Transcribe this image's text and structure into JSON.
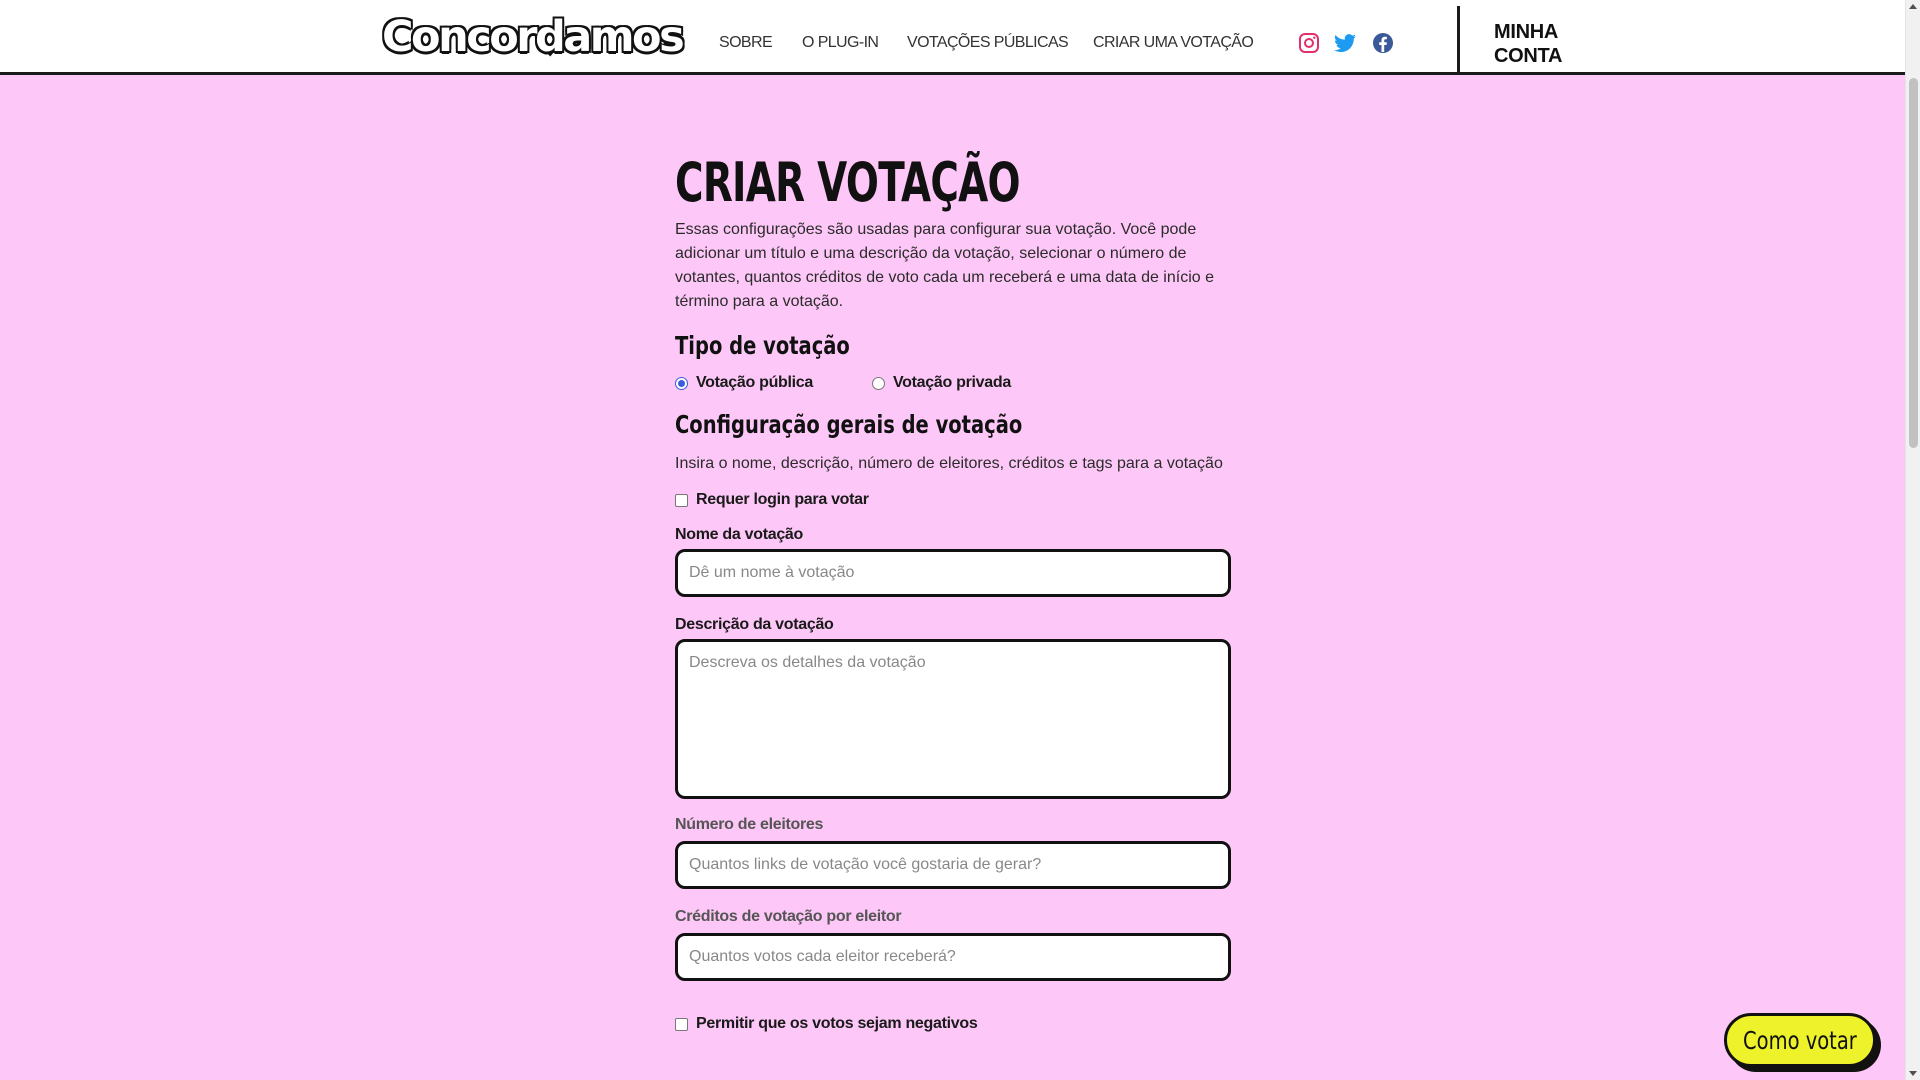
{
  "header": {
    "logo": "Concordamos",
    "nav": [
      {
        "label": "SOBRE"
      },
      {
        "label": "O PLUG-IN"
      },
      {
        "label": "VOTAÇÕES PÚBLICAS"
      },
      {
        "label": "CRIAR UMA VOTAÇÃO"
      }
    ],
    "social": [
      {
        "icon": "instagram-icon",
        "color": "#e1306c"
      },
      {
        "icon": "twitter-icon",
        "color": "#1d9bf0"
      },
      {
        "icon": "facebook-icon",
        "color": "#3b5998"
      }
    ],
    "account_line1": "MINHA",
    "account_line2": "CONTA"
  },
  "form": {
    "title": "CRIAR VOTAÇÃO",
    "intro": "Essas configurações são usadas para configurar sua votação. Você pode adicionar um título e uma descrição da votação, selecionar o número de votantes, quantos créditos de voto cada um receberá e uma data de início e término para a votação.",
    "type_section": "Tipo de votação",
    "type_options": [
      {
        "label": "Votação pública",
        "checked": true
      },
      {
        "label": "Votação privada",
        "checked": false
      }
    ],
    "general_section": "Configuração gerais de votação",
    "general_desc": "Insira o nome, descrição, número de eleitores, créditos e tags para a votação",
    "require_login_label": "Requer login para votar",
    "name_label": "Nome da votação",
    "name_placeholder": "Dê um nome à votação",
    "description_label": "Descrição da votação",
    "description_placeholder": "Descreva os detalhes da votação",
    "voters_label": "Número de eleitores",
    "voters_placeholder": "Quantos links de votação você gostaria de gerar?",
    "credits_label": "Créditos de votação por eleitor",
    "credits_placeholder": "Quantos votos cada eleitor receberá?",
    "negative_votes_label": "Permitir que os votos sejam negativos"
  },
  "help_button": "Como votar",
  "colors": {
    "page_background": "#fdc8f7",
    "accent_button": "#eef22a",
    "radio_accent": "#3b5bdb"
  }
}
